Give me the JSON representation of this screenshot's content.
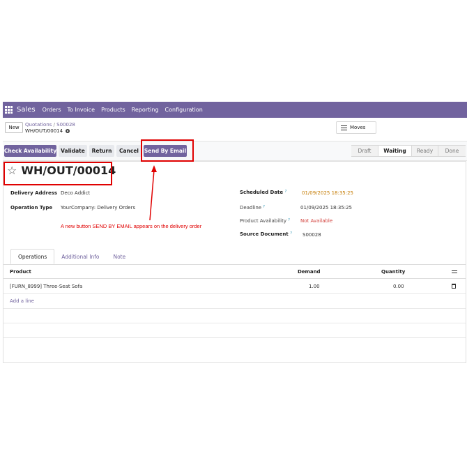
{
  "navbar": {
    "app_name": "Sales",
    "menu": [
      "Orders",
      "To Invoice",
      "Products",
      "Reporting",
      "Configuration"
    ]
  },
  "control": {
    "new_label": "New",
    "breadcrumb_parent": "Quotations",
    "breadcrumb_sep": "/",
    "breadcrumb_order": "S00028",
    "record_ref": "WH/OUT/00014",
    "moves_label": "Moves"
  },
  "actions": {
    "check_availability": "Check Availability",
    "validate": "Validate",
    "return": "Return",
    "cancel": "Cancel",
    "send_by_email": "Send By Email"
  },
  "status": {
    "stages": [
      "Draft",
      "Waiting",
      "Ready",
      "Done"
    ],
    "current": "Waiting"
  },
  "record": {
    "title": "WH/OUT/00014",
    "delivery_address_label": "Delivery Address",
    "delivery_address": "Deco Addict",
    "operation_type_label": "Operation Type",
    "operation_type": "YourCompany: Delivery Orders",
    "scheduled_date_label": "Scheduled Date",
    "scheduled_date": "01/09/2025 18:35:25",
    "deadline_label": "Deadline",
    "deadline": "01/09/2025 18:35:25",
    "availability_label": "Product Availability",
    "availability": "Not Available",
    "source_label": "Source Document",
    "source": "S00028",
    "tooltip_mark": "?"
  },
  "annotation": "A new button SEND BY EMAIL appears on the delivery order",
  "tabs": [
    "Operations",
    "Additional Info",
    "Note"
  ],
  "table": {
    "headers": {
      "product": "Product",
      "demand": "Demand",
      "quantity": "Quantity"
    },
    "rows": [
      {
        "product": "[FURN_8999] Three-Seat Sofa",
        "demand": "1.00",
        "quantity": "0.00"
      }
    ],
    "add_line": "Add a line"
  },
  "colors": {
    "brand": "#71639e",
    "highlight": "#e00000",
    "warning": "#c47a00",
    "danger": "#d23f3a"
  }
}
